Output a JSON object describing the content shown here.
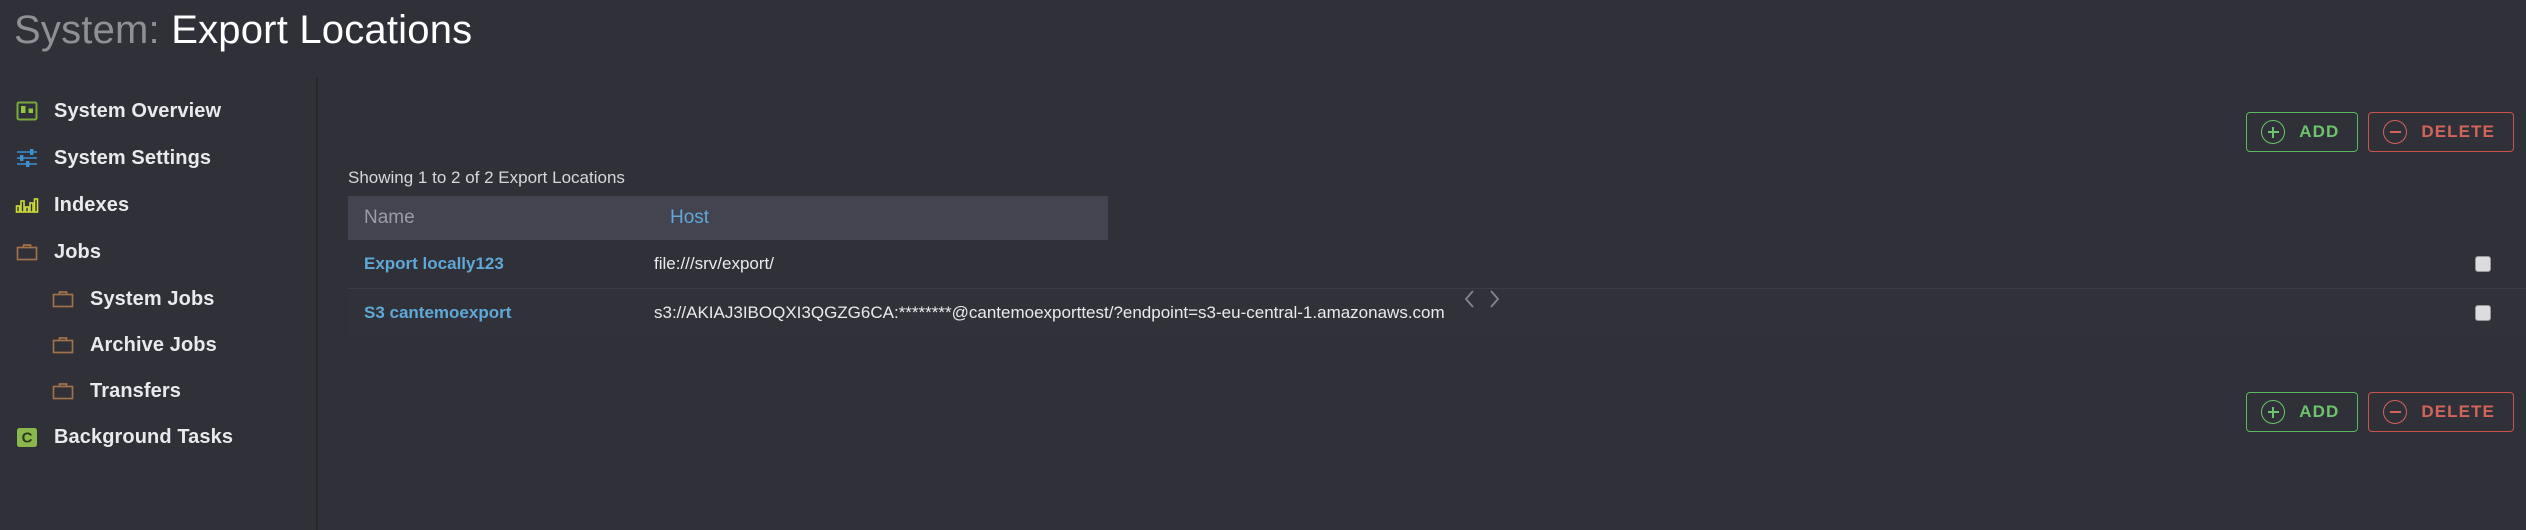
{
  "header": {
    "scope": "System:",
    "title": "Export Locations"
  },
  "sidebar": {
    "items": [
      {
        "label": "System Overview",
        "icon": "system-overview-icon",
        "level": 0
      },
      {
        "label": "System Settings",
        "icon": "system-settings-icon",
        "level": 0
      },
      {
        "label": "Indexes",
        "icon": "indexes-icon",
        "level": 0
      },
      {
        "label": "Jobs",
        "icon": "jobs-briefcase-icon",
        "level": 0
      },
      {
        "label": "System Jobs",
        "icon": "jobs-briefcase-icon",
        "level": 1
      },
      {
        "label": "Archive Jobs",
        "icon": "jobs-briefcase-icon",
        "level": 1
      },
      {
        "label": "Transfers",
        "icon": "jobs-briefcase-icon",
        "level": 1
      },
      {
        "label": "Background Tasks",
        "icon": "background-tasks-icon",
        "level": 0
      }
    ]
  },
  "toolbar": {
    "add_label": "ADD",
    "delete_label": "DELETE"
  },
  "main": {
    "showing": "Showing 1 to 2 of 2 Export Locations",
    "columns": [
      "Name",
      "Host"
    ],
    "rows": [
      {
        "name": "Export locally123",
        "host": "file:///srv/export/",
        "selected": false
      },
      {
        "name": "S3 cantemoexport",
        "host": "s3://AKIAJ3IBOQXI3QGZG6CA:********@cantemoexporttest/?endpoint=s3-eu-central-1.amazonaws.com",
        "selected": false
      }
    ],
    "pagination": {
      "prev_icon": "chevron-left-icon",
      "next_icon": "chevron-right-icon"
    }
  },
  "colors": {
    "background": "#2f3038",
    "header_band": "#43444f",
    "link": "#5fa8d8",
    "add_green": "#6cc46c",
    "delete_red": "#d4635a",
    "muted": "#9c9da4"
  }
}
